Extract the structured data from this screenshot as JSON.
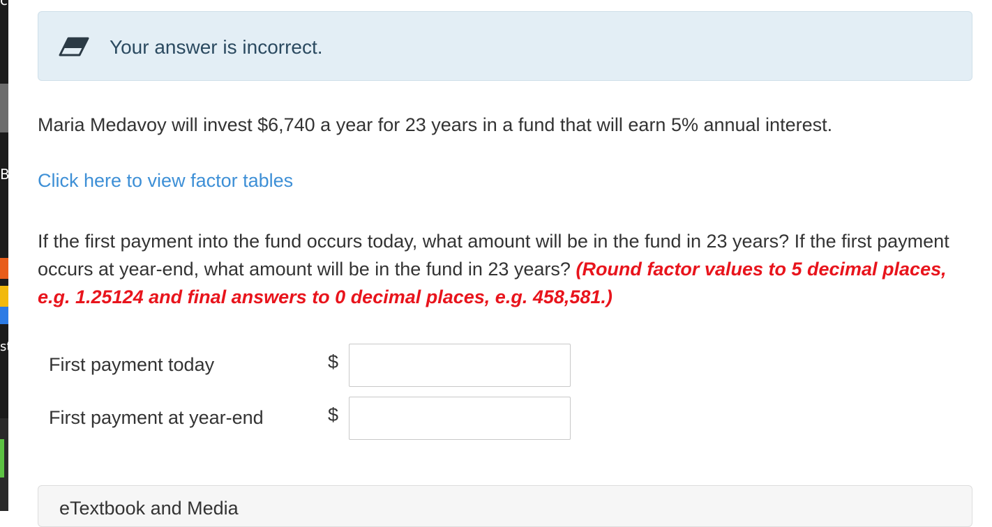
{
  "feedback": {
    "icon": "eraser-icon",
    "message": "Your answer is incorrect."
  },
  "problem": {
    "statement": "Maria Medavoy will invest $6,740 a year for 23 years in a fund that will earn 5% annual interest.",
    "factor_link": "Click here to view factor tables",
    "question": "If the first payment into the fund occurs today, what amount will be in the fund in 23 years? If the first payment occurs at year-end, what amount will be in the fund in 23 years?",
    "instruction": "(Round factor values to 5 decimal places, e.g. 1.25124 and final answers to 0 decimal places, e.g. 458,581.)"
  },
  "answers": [
    {
      "label": "First payment today",
      "currency": "$",
      "value": ""
    },
    {
      "label": "First payment at year-end",
      "currency": "$",
      "value": ""
    }
  ],
  "resources": {
    "title": "eTextbook and Media"
  },
  "sidebar_fragments": {
    "top": "c",
    "mid": "B",
    "lower": "st"
  },
  "colors": {
    "alert_bg": "#e3eef5",
    "link": "#3d8fd6",
    "hint": "#e8141c"
  }
}
